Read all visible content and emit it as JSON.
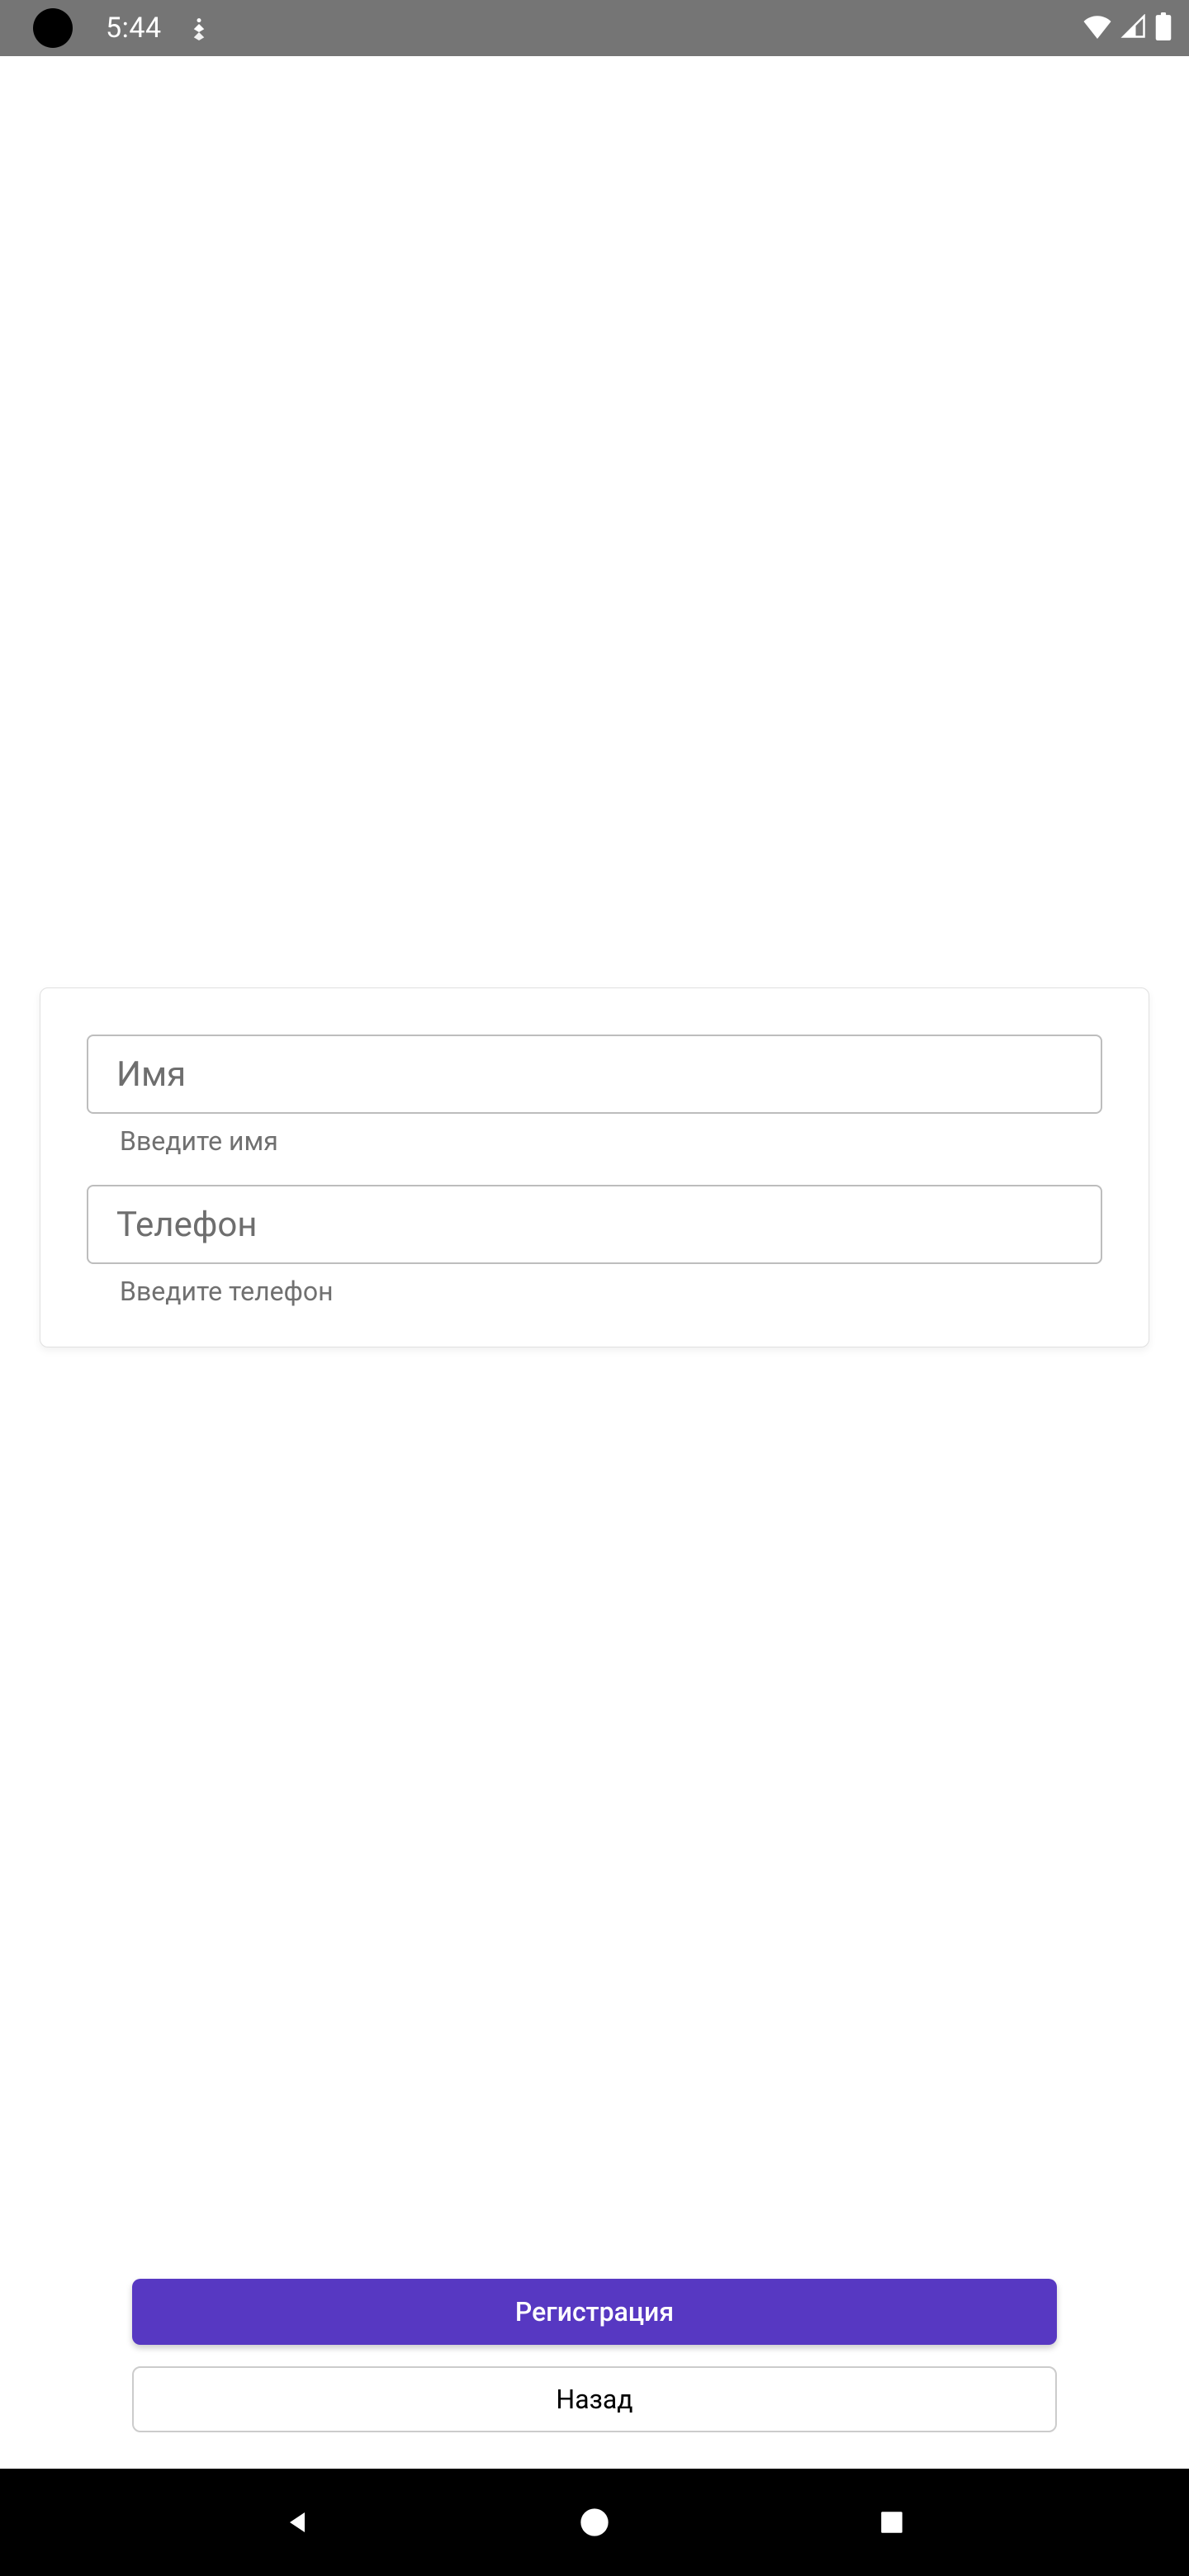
{
  "status": {
    "time": "5:44"
  },
  "form": {
    "name": {
      "label": "Имя",
      "helper": "Введите имя"
    },
    "phone": {
      "label": "Телефон",
      "helper": "Введите телефон"
    }
  },
  "buttons": {
    "register": "Регистрация",
    "back": "Назад"
  }
}
